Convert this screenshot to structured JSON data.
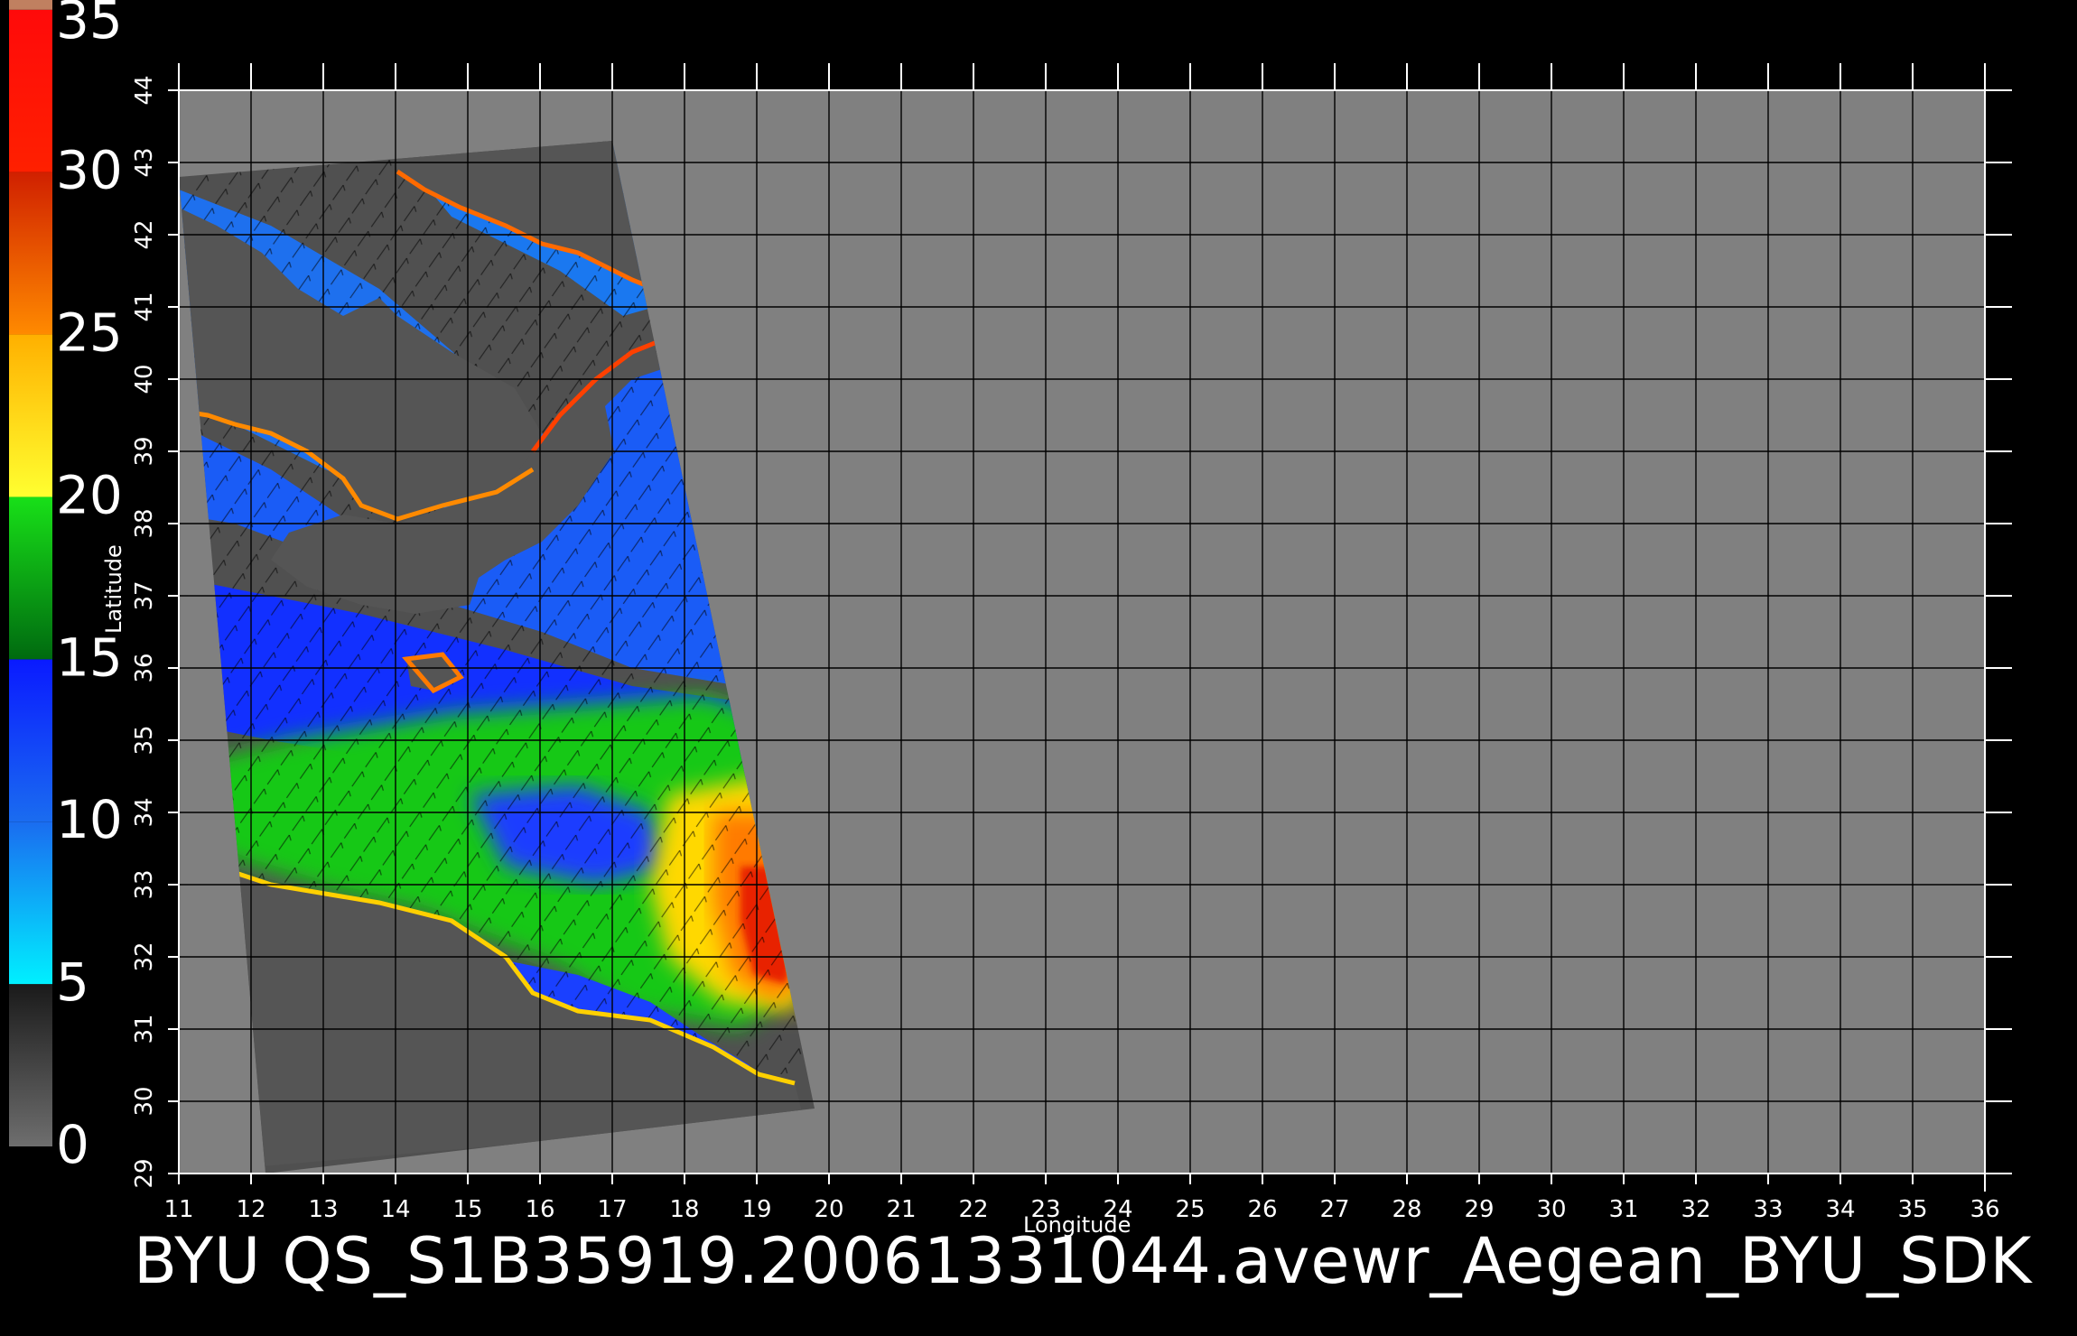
{
  "chart_data": {
    "type": "heatmap",
    "caption": "BYU QS_S1B35919.20061331044.avewr_Aegean_BYU_SDK",
    "xlabel": "Longitude",
    "ylabel": "Latitude",
    "xlim": [
      11,
      36
    ],
    "ylim": [
      29,
      44
    ],
    "x_ticks": [
      "11",
      "12",
      "13",
      "14",
      "15",
      "16",
      "17",
      "18",
      "19",
      "20",
      "21",
      "22",
      "23",
      "24",
      "25",
      "26",
      "27",
      "28",
      "29",
      "30",
      "31",
      "32",
      "33",
      "34",
      "35",
      "36"
    ],
    "y_ticks": [
      "29",
      "30",
      "31",
      "32",
      "33",
      "34",
      "35",
      "36",
      "37",
      "38",
      "39",
      "40",
      "41",
      "42",
      "43",
      "44"
    ],
    "grid": true,
    "colorbar": {
      "position": "left",
      "ticks": [
        "0",
        "5",
        "10",
        "15",
        "20",
        "25",
        "30",
        "35"
      ],
      "range": [
        0,
        35
      ],
      "bands": [
        {
          "from": 0,
          "to": 5,
          "colors": [
            "#6e6e6e",
            "#1a1a1a"
          ]
        },
        {
          "from": 5,
          "to": 10,
          "colors": [
            "#00f0ff",
            "#1a6cf0"
          ]
        },
        {
          "from": 10,
          "to": 15,
          "colors": [
            "#1a6cf0",
            "#0a1aff"
          ]
        },
        {
          "from": 15,
          "to": 20,
          "colors": [
            "#006a10",
            "#18e018"
          ]
        },
        {
          "from": 20,
          "to": 25,
          "colors": [
            "#ffff30",
            "#ffb000"
          ]
        },
        {
          "from": 25,
          "to": 30,
          "colors": [
            "#ff8a00",
            "#d02000"
          ]
        },
        {
          "from": 30,
          "to": 35,
          "colors": [
            "#ff2000",
            "#ff0a0a"
          ]
        },
        {
          "from": 35,
          "to": 36,
          "colors": [
            "#c08060",
            "#c08060"
          ]
        }
      ]
    },
    "colors": {
      "background": "#000000",
      "plot_background": "#808080",
      "swath_background": "#505050",
      "grid": "#000000",
      "text": "#ffffff"
    },
    "swath_corners_lonlat": [
      [
        11.0,
        42.8
      ],
      [
        17.0,
        43.3
      ],
      [
        19.8,
        29.9
      ],
      [
        12.2,
        29.0
      ]
    ]
  }
}
